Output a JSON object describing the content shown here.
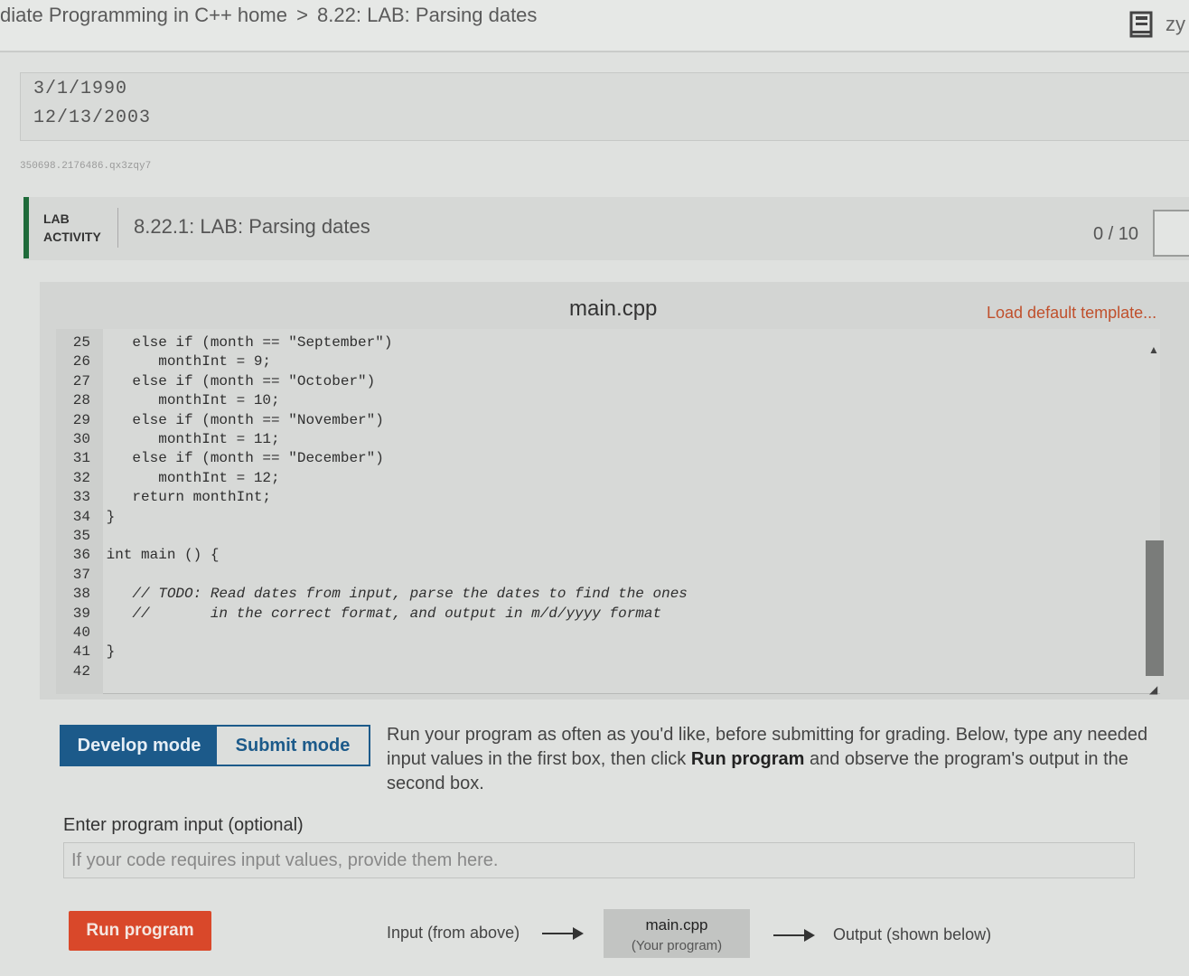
{
  "header": {
    "breadcrumb_course": "diate Programming in C++ home",
    "breadcrumb_separator": ">",
    "breadcrumb_section": "8.22: LAB: Parsing dates",
    "brand_partial": "zy",
    "book_icon": "book-icon"
  },
  "example_output": {
    "lines": [
      "3/1/1990",
      "12/13/2003"
    ],
    "id_text": "350698.2176486.qx3zqy7"
  },
  "lab": {
    "tag_line1": "LAB",
    "tag_line2": "ACTIVITY",
    "title": "8.22.1: LAB: Parsing dates",
    "score": "0 / 10",
    "accent_color": "#1f6b3a"
  },
  "editor": {
    "file_name": "main.cpp",
    "load_template": "Load default template...",
    "lines": [
      {
        "n": "25",
        "code": "    else if (month == \"September\")",
        "comment": false
      },
      {
        "n": "26",
        "code": "       monthInt = 9;",
        "comment": false
      },
      {
        "n": "27",
        "code": "    else if (month == \"October\")",
        "comment": false
      },
      {
        "n": "28",
        "code": "       monthInt = 10;",
        "comment": false
      },
      {
        "n": "29",
        "code": "    else if (month == \"November\")",
        "comment": false
      },
      {
        "n": "30",
        "code": "       monthInt = 11;",
        "comment": false
      },
      {
        "n": "31",
        "code": "    else if (month == \"December\")",
        "comment": false
      },
      {
        "n": "32",
        "code": "       monthInt = 12;",
        "comment": false
      },
      {
        "n": "33",
        "code": "    return monthInt;",
        "comment": false
      },
      {
        "n": "34",
        "code": " }",
        "comment": false
      },
      {
        "n": "35",
        "code": "",
        "comment": false
      },
      {
        "n": "36",
        "code": " int main () {",
        "comment": false
      },
      {
        "n": "37",
        "code": "",
        "comment": false
      },
      {
        "n": "38",
        "code": "    // TODO: Read dates from input, parse the dates to find the ones",
        "comment": true
      },
      {
        "n": "39",
        "code": "    //       in the correct format, and output in m/d/yyyy format",
        "comment": true
      },
      {
        "n": "40",
        "code": "",
        "comment": false
      },
      {
        "n": "41",
        "code": " }",
        "comment": false
      },
      {
        "n": "42",
        "code": "",
        "comment": false
      }
    ]
  },
  "modes": {
    "develop": "Develop mode",
    "submit": "Submit mode",
    "desc_part1": "Run your program as often as you'd like, before submitting for grading. Below, type any needed input values in the first box, then click ",
    "desc_bold": "Run program",
    "desc_part2": " and observe the program's output in the second box."
  },
  "input": {
    "label": "Enter program input (optional)",
    "placeholder": "If your code requires input values, provide them here."
  },
  "run": {
    "button": "Run program",
    "input_label": "Input (from above)",
    "program_name": "main.cpp",
    "program_sub": "(Your program)",
    "output_label": "Output (shown below)",
    "button_color": "#d9482a"
  }
}
